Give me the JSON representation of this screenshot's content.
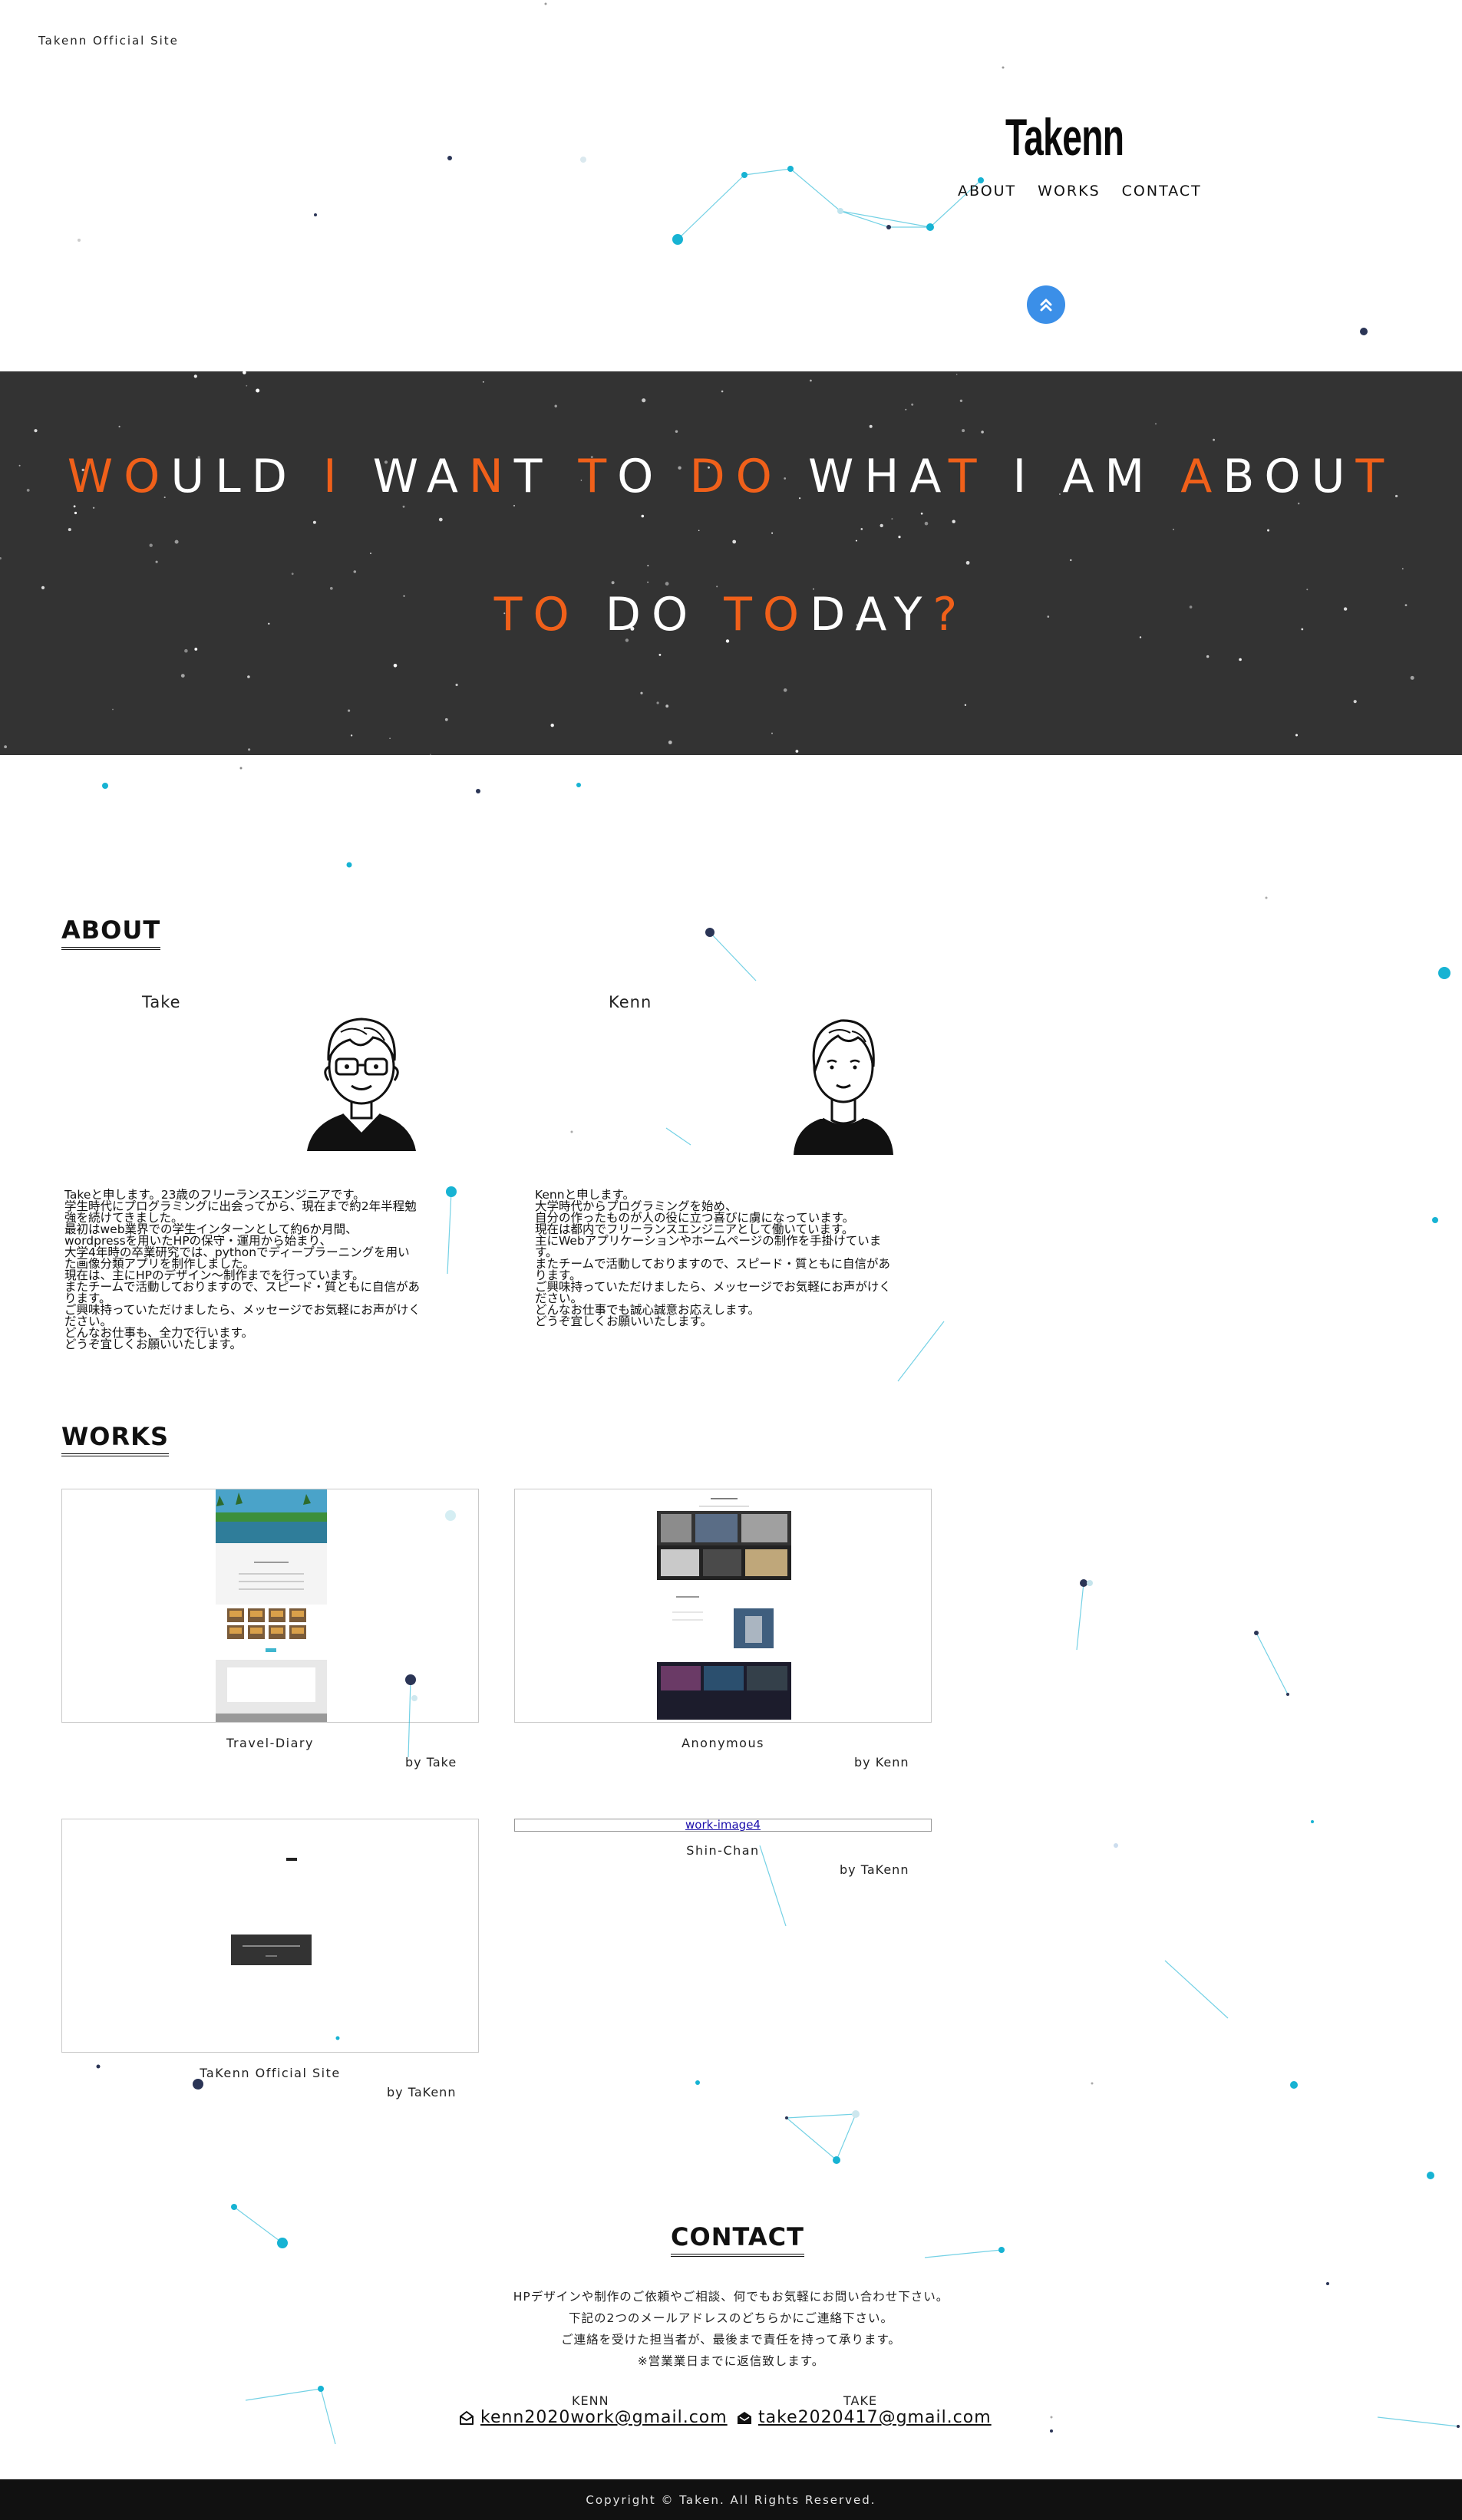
{
  "site": {
    "label": "Takenn Official Site",
    "logo": "Takenn"
  },
  "nav": {
    "items": [
      "ABOUT",
      "WORKS",
      "CONTACT"
    ]
  },
  "scroll_button": {
    "icon": "double-chevron-up-icon"
  },
  "hero": {
    "line1": "WOULD I WANT TO DO WHAT I AM ABOUT",
    "line2": "TO DO TODAY?",
    "accent_color": "#f0601a",
    "background": "#333333"
  },
  "about": {
    "title": "ABOUT",
    "take": {
      "name": "Take",
      "lines": [
        "Takeと申します。23歳のフリーランスエンジニアです。",
        "学生時代にプログラミングに出会ってから、現在まで約2年半程勉",
        "強を続けてきました。",
        "最初はweb業界での学生インターンとして約6か月間、",
        "wordpressを用いたHPの保守・運用から始まり、",
        "大学4年時の卒業研究では、pythonでディープラーニングを用い",
        "た画像分類アプリを制作しました。",
        "現在は、主にHPのデザイン〜制作までを行っています。",
        "またチームで活動しておりますので、スピード・質ともに自信があ",
        "ります。",
        "ご興味持っていただけましたら、メッセージでお気軽にお声がけく",
        "ださい。",
        "どんなお仕事も、全力で行います。",
        "どうぞ宜しくお願いいたします。"
      ]
    },
    "kenn": {
      "name": "Kenn",
      "lines": [
        "Kennと申します。",
        "大学時代からプログラミングを始め、",
        "自分の作ったものが人の役に立つ喜びに虜になっています。",
        "現在は都内でフリーランスエンジニアとして働いています。",
        "主にWebアプリケーションやホームページの制作を手掛けていま",
        "す。",
        "またチームで活動しておりますので、スピード・質ともに自信があ",
        "ります。",
        "ご興味持っていただけましたら、メッセージでお気軽にお声がけく",
        "ださい。",
        "どんなお仕事でも誠心誠意お応えします。",
        "どうぞ宜しくお願いいたします。"
      ]
    }
  },
  "works": {
    "title": "WORKS",
    "items": [
      {
        "title": "Travel-Diary",
        "author": "by Take"
      },
      {
        "title": "Anonymous",
        "author": "by Kenn"
      },
      {
        "title": "TaKenn Official Site",
        "author": "by TaKenn"
      },
      {
        "title": "Shin-Chan",
        "author": "by TaKenn",
        "image_alt": "work-image4"
      }
    ]
  },
  "contact": {
    "title": "CONTACT",
    "lines": [
      "HPデザインや制作のご依頼やご相談、何でもお気軽にお問い合わせ下さい。",
      "下記の2つのメールアドレスのどちらかにご連絡下さい。",
      "ご連絡を受けた担当者が、最後まで責任を持って承ります。",
      "※営業業日までに返信致します。"
    ],
    "kenn": {
      "label": "KENN",
      "email": "kenn2020work@gmail.com",
      "icon": "envelope-open-icon"
    },
    "take": {
      "label": "TAKE",
      "email": "take2020417@gmail.com",
      "icon": "envelope-icon"
    }
  },
  "footer": {
    "copyright": "Copyright © Taken. All Rights Reserved."
  },
  "colors": {
    "particle": "#17b3d3",
    "particle_dark": "#2b3556",
    "button": "#3b8fe8",
    "footer": "#111111"
  }
}
